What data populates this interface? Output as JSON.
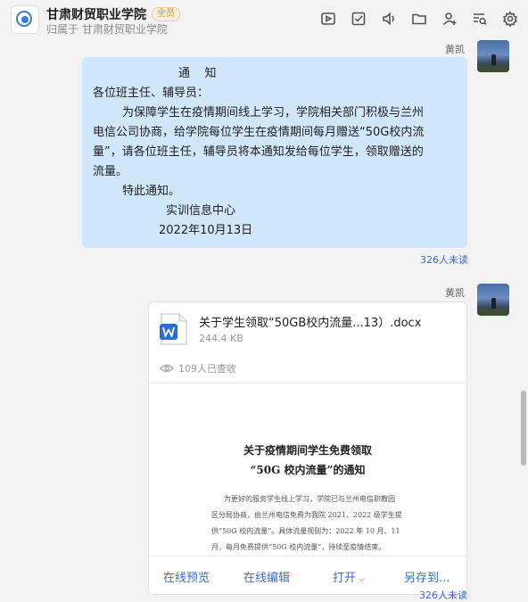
{
  "header": {
    "title": "甘肃财贸职业学院",
    "badge": "全员",
    "subtitle": "归属于 甘肃财贸职业学院",
    "icons": [
      "video-icon",
      "checklist-icon",
      "voice-icon",
      "folder-icon",
      "add-member-icon",
      "search-list-icon",
      "settings-icon"
    ]
  },
  "message1": {
    "sender": "黄凯",
    "heading": "通    知",
    "lines": [
      "各位班主任、辅导员：",
      "        为保障学生在疫情期间线上学习，学院相关部门积极与兰州",
      "电信公司协商，给学院每位学生在疫情期间每月赠送“50G校内流",
      "量”，请各位班主任，辅导员将本通知发给每位学生，领取赠送的",
      "流量。",
      "        特此通知。"
    ],
    "signature": "实训信息中心",
    "date": "2022年10月13日",
    "unread": "326人未读"
  },
  "message2": {
    "sender": "黄凯",
    "file": {
      "name": "关于学生领取“50GB校内流量...13）.docx",
      "size": "244.4 KB",
      "viewed": "109人已查收",
      "preview_title_1": "关于疫情期间学生免费领取",
      "preview_title_2": "“50G 校内流量”的通知",
      "preview_lines": [
        "为更好的服务学生线上学习，学院已与兰州电信职教园",
        "区分局协商，由兰州电信免费为我院 2021、2022 级学生提",
        "供“50G 校内流量”。具体流量规则为：2022 年 10 月、11",
        "月，每月免费提供“50G 校内流量”，持续至疫情结束。"
      ]
    },
    "actions": {
      "preview": "在线预览",
      "edit": "在线编辑",
      "open": "打开",
      "save_as": "另存到..."
    },
    "unread": "326人未读"
  },
  "colors": {
    "bubble": "#cfe6fb",
    "link": "#3a6ec9",
    "badge": "#e8891e"
  }
}
